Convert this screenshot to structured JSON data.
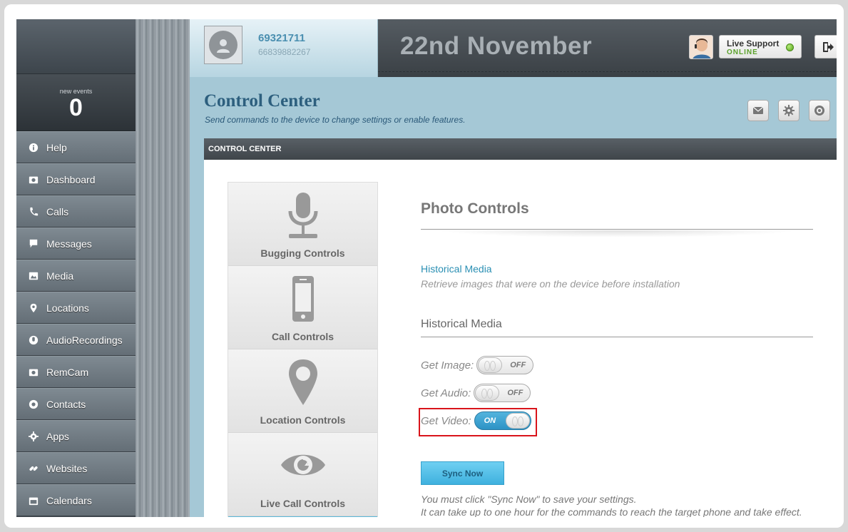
{
  "sidebar": {
    "events_label": "new events",
    "events_count": "0",
    "items": [
      {
        "label": "Help",
        "icon": "info-icon"
      },
      {
        "label": "Dashboard",
        "icon": "camera-icon"
      },
      {
        "label": "Calls",
        "icon": "phone-icon"
      },
      {
        "label": "Messages",
        "icon": "chat-icon"
      },
      {
        "label": "Media",
        "icon": "image-icon"
      },
      {
        "label": "Locations",
        "icon": "pin-icon"
      },
      {
        "label": "AudioRecordings",
        "icon": "microphone-icon"
      },
      {
        "label": "RemCam",
        "icon": "camera-icon"
      },
      {
        "label": "Contacts",
        "icon": "at-icon"
      },
      {
        "label": "Apps",
        "icon": "gear-icon"
      },
      {
        "label": "Websites",
        "icon": "link-icon"
      },
      {
        "label": "Calendars",
        "icon": "calendar-icon"
      }
    ]
  },
  "header": {
    "user_id": "69321711",
    "user_phone": "66839882267",
    "date": "22nd November",
    "support_label": "Live Support",
    "support_status": "ONLINE"
  },
  "page": {
    "title": "Control Center",
    "subtitle": "Send commands to the device to change settings or enable features.",
    "section_label": "CONTROL CENTER"
  },
  "tabs": [
    {
      "label": "Bugging Controls",
      "icon": "microphone-icon"
    },
    {
      "label": "Call Controls",
      "icon": "mobile-phone-icon"
    },
    {
      "label": "Location Controls",
      "icon": "map-pin-icon"
    },
    {
      "label": "Live Call Controls",
      "icon": "eye-icon"
    }
  ],
  "panel": {
    "title": "Photo Controls",
    "link": "Historical Media",
    "link_desc": "Retrieve images that were on the device before installation",
    "subsection": "Historical Media",
    "toggles": [
      {
        "label": "Get Image:",
        "state": "OFF"
      },
      {
        "label": "Get Audio:",
        "state": "OFF"
      },
      {
        "label": "Get Video:",
        "state": "ON"
      }
    ],
    "sync_label": "Sync Now",
    "note_1": "You must click \"Sync Now\" to save your settings.",
    "note_2": "It can take up to one hour for the commands to reach the target phone and take effect."
  },
  "colors": {
    "accent": "#3fb1de",
    "highlight": "#d9141b",
    "title": "#2d5f7e",
    "online": "#5aa12a"
  }
}
